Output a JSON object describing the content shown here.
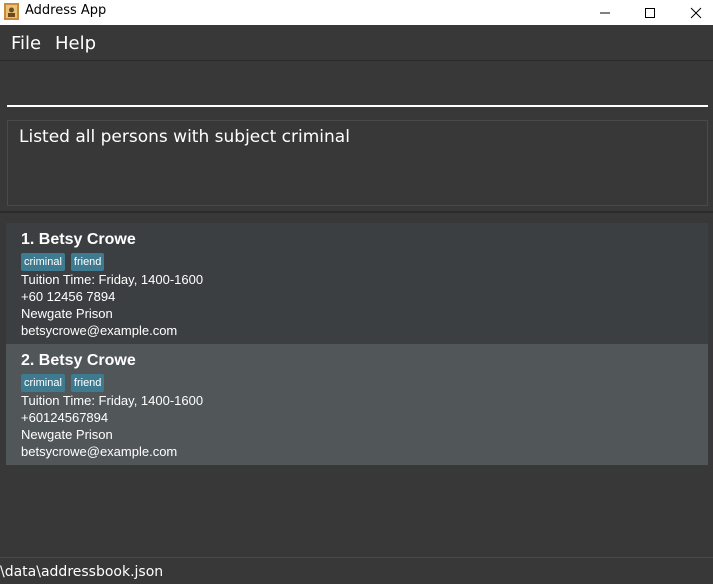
{
  "window": {
    "title": "Address App",
    "minimize_icon": "minimize-icon",
    "maximize_icon": "maximize-icon",
    "close_icon": "close-icon",
    "app_icon": "address-book-icon"
  },
  "menu": {
    "file": "File",
    "help": "Help"
  },
  "command": {
    "value": ""
  },
  "result": {
    "message": "Listed all persons with subject criminal"
  },
  "persons": [
    {
      "name": "1. Betsy Crowe",
      "tags": [
        "criminal",
        "friend"
      ],
      "tuition": "Tuition Time: Friday, 1400-1600",
      "phone": "+60 12456 7894",
      "address": "Newgate Prison",
      "email": "betsycrowe@example.com"
    },
    {
      "name": "2. Betsy Crowe",
      "tags": [
        "criminal",
        "friend"
      ],
      "tuition": "Tuition Time: Friday, 1400-1600",
      "phone": "+60124567894",
      "address": "Newgate Prison",
      "email": "betsycrowe@example.com"
    }
  ],
  "status": {
    "path": "\\data\\addressbook.json"
  },
  "colors": {
    "background": "#383838",
    "card_default": "#3c3f41",
    "card_selected": "#515658",
    "tag": "#3e7b91"
  }
}
